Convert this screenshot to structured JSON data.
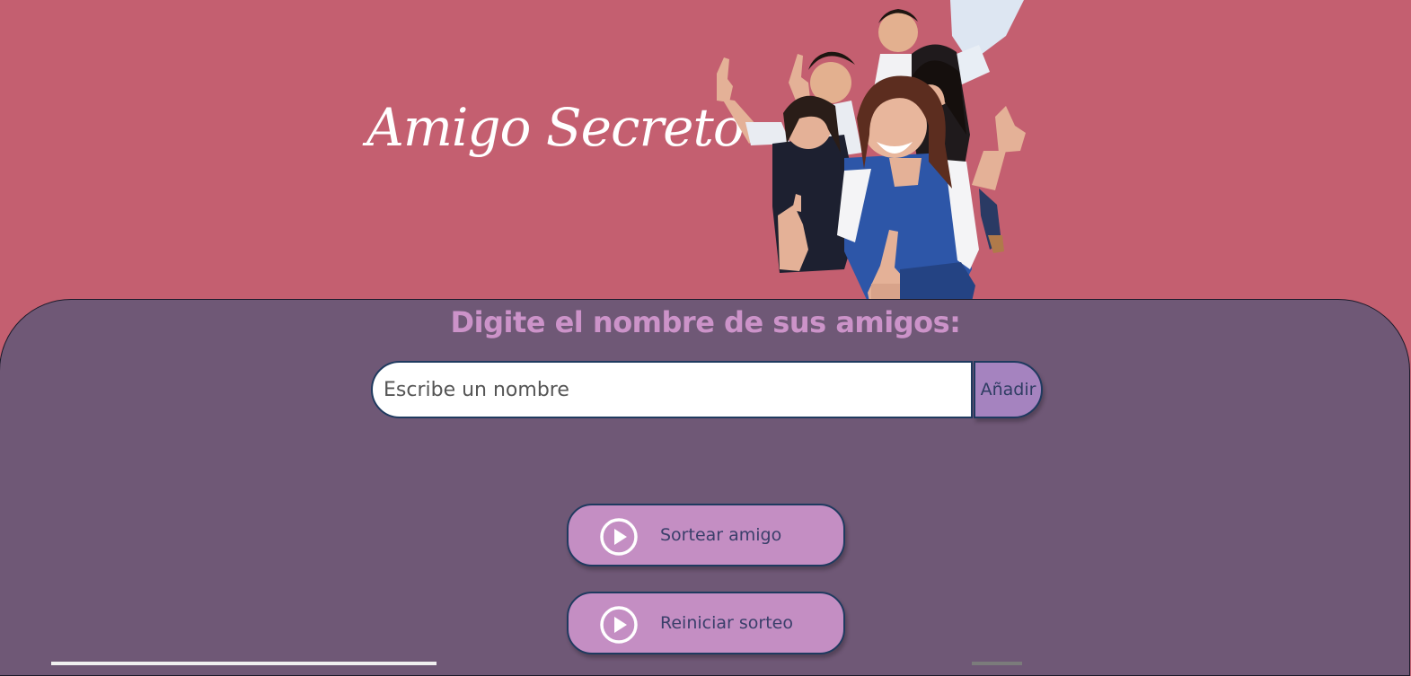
{
  "header": {
    "title": "Amigo Secreto",
    "hero_image_icon": "group-of-friends-thumbs-up-illustration"
  },
  "main": {
    "section_title": "Digite el nombre de sus amigos:",
    "name_input": {
      "placeholder": "Escribe un nombre",
      "value": ""
    },
    "add_button_label": "Añadir",
    "friends": [],
    "results": []
  },
  "actions": {
    "draw_label": "Sortear amigo",
    "draw_icon": "play-circle-icon",
    "reset_label": "Reiniciar sorteo",
    "reset_icon": "play-circle-icon"
  },
  "colors": {
    "header_background": "#c45f70",
    "panel_background": "#6f5876",
    "section_title": "#cc93c9",
    "add_button": "#a583bf",
    "action_button": "#c48ec3",
    "button_border": "#1f3a5f",
    "button_text": "#3a3f6a",
    "title_text": "#ffffff"
  }
}
